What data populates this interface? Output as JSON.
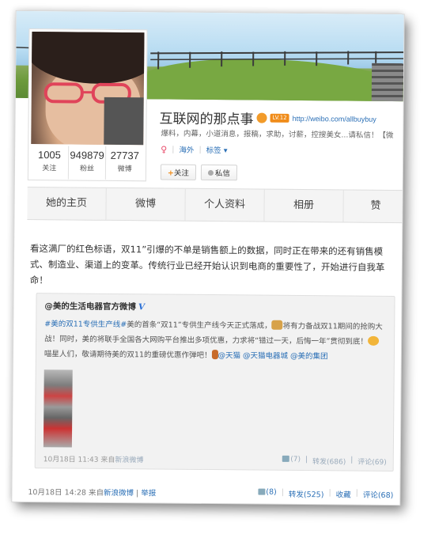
{
  "profile": {
    "name": "互联网的那点事",
    "vip_badge": "LV.12",
    "url": "http://weibo.com/allbuybuy",
    "description": "爆料，内幕，小道消息，报稿，求助，讨薪，控搜美女...请私信！【微",
    "location": "海外",
    "tags_label": "标签",
    "follow_label": "关注",
    "message_label": "私信",
    "stats": [
      {
        "num": "1005",
        "label": "关注"
      },
      {
        "num": "949879",
        "label": "粉丝"
      },
      {
        "num": "27737",
        "label": "微博"
      }
    ]
  },
  "tabs": [
    "她的主页",
    "微博",
    "个人资料",
    "相册",
    "赞"
  ],
  "post": {
    "text": "看这满厂的红色标语，双11”引爆的不单是销售额上的数据，同时正在带来的还有销售模式、制造业、渠道上的变革。传统行业已经开始认识到电商的重要性了，开始进行自我革命！",
    "repost": {
      "author": "@美的生活电器官方微博",
      "verified": "V",
      "topic": "#美的双11专供生产线#",
      "text1": "美的首条“双11”专供生产线今天正式落成，",
      "text2": "将有力备战双11期间的抢购大战！同时，美的将联手全国各大网购平台推出多项优惠，力求将“错过一天，后悔一年”贯彻到底！",
      "text3": "喵星人们，敬请期待美的双11的重磅优惠作弹吧！",
      "mentions": "@天猫 @天猫电器城 @美的集团",
      "time": "10月18日 11:43",
      "source_prefix": "来自",
      "source": "新浪微博",
      "like": "(7)",
      "forward": "转发(686)",
      "comment": "评论(69)"
    },
    "time": "10月18日 14:28",
    "source_prefix": "来自",
    "source": "新浪微博",
    "report": "举报",
    "like": "(8)",
    "forward": "转发(525)",
    "favorite": "收藏",
    "comment": "评论(68)"
  },
  "colors": {
    "link": "#2a6fb6",
    "vip": "#f08c1a"
  }
}
